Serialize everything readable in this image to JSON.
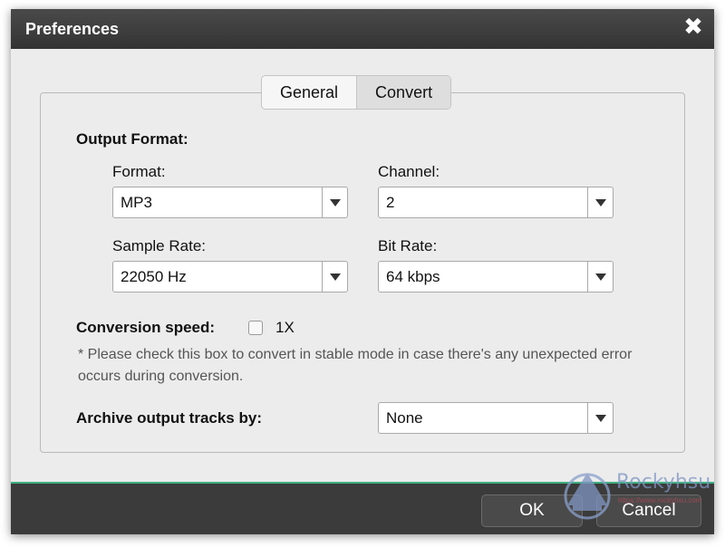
{
  "window": {
    "title": "Preferences",
    "close_glyph": "✖"
  },
  "tabs": [
    {
      "label": "General",
      "active": false
    },
    {
      "label": "Convert",
      "active": true
    }
  ],
  "output_format": {
    "heading": "Output Format:",
    "format": {
      "label": "Format:",
      "value": "MP3"
    },
    "channel": {
      "label": "Channel:",
      "value": "2"
    },
    "sample_rate": {
      "label": "Sample Rate:",
      "value": "22050 Hz"
    },
    "bit_rate": {
      "label": "Bit Rate:",
      "value": "64 kbps"
    }
  },
  "conversion_speed": {
    "label": "Conversion speed:",
    "checkbox_label": "1X",
    "checked": false,
    "note": "* Please check this box to convert in stable mode in case there's any unexpected error occurs during conversion."
  },
  "archive": {
    "label": "Archive output tracks by:",
    "value": "None"
  },
  "footer": {
    "ok_label": "OK",
    "cancel_label": "Cancel"
  },
  "watermark": {
    "text": "Rockyhsu",
    "subtext": "https://www.rockyhsu.com"
  },
  "colors": {
    "titlebar": "#333333",
    "footer": "#3b3b3b",
    "accent_line": "#40b183",
    "dialog_bg": "#ececec"
  }
}
